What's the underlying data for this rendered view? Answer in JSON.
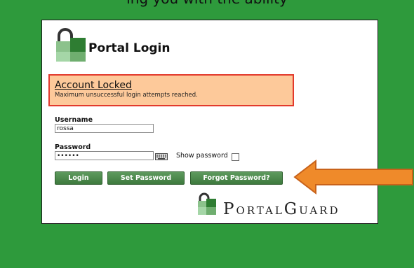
{
  "caption": "ing you with the ability",
  "login": {
    "title": "Portal Login",
    "alert": {
      "title": "Account Locked",
      "message": "Maximum unsuccessful login attempts reached."
    },
    "username_label": "Username",
    "username_value": "rossa",
    "password_label": "Password",
    "password_value": "••••••",
    "show_password_label": "Show password",
    "show_password_checked": false,
    "buttons": {
      "login": "Login",
      "set_password": "Set Password",
      "forgot_password": "Forgot Password?"
    }
  },
  "brand": {
    "name_parts": [
      "P",
      "ORTAL",
      "G",
      "UARD"
    ]
  },
  "colors": {
    "background": "#2e9a3c",
    "alert_background": "#fdc99a",
    "alert_border": "#e23a2c",
    "button": "#4a874a",
    "arrow": "#ef8a2a"
  },
  "icons": [
    "lock-logo-icon",
    "keyboard-icon",
    "portalguard-lock-icon",
    "arrow-left-icon"
  ]
}
